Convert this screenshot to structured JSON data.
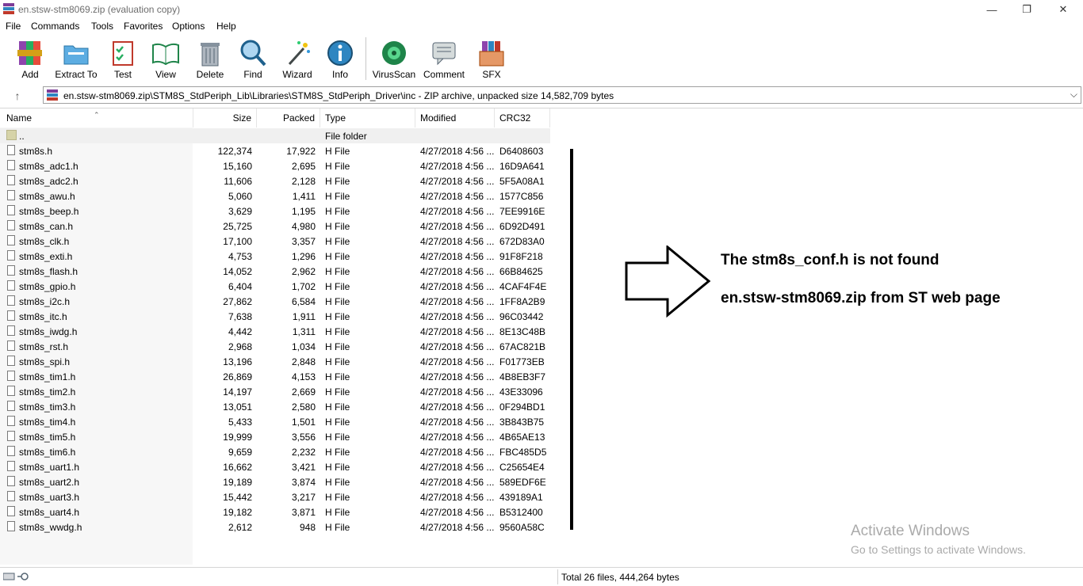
{
  "window": {
    "title": "en.stsw-stm8069.zip (evaluation copy)",
    "controls": {
      "minimize": "—",
      "restore": "❐",
      "close": "✕"
    }
  },
  "menu": [
    "File",
    "Commands",
    "Tools",
    "Favorites",
    "Options",
    "Help"
  ],
  "toolbar": {
    "buttons": [
      "Add",
      "Extract To",
      "Test",
      "View",
      "Delete",
      "Find",
      "Wizard",
      "Info",
      "VirusScan",
      "Comment",
      "SFX"
    ]
  },
  "address": {
    "path": "en.stsw-stm8069.zip\\STM8S_StdPeriph_Lib\\Libraries\\STM8S_StdPeriph_Driver\\inc - ZIP archive, unpacked size 14,582,709 bytes"
  },
  "columns": [
    "Name",
    "Size",
    "Packed",
    "Type",
    "Modified",
    "CRC32"
  ],
  "parent_row": {
    "name": "..",
    "type": "File folder"
  },
  "files": [
    {
      "name": "stm8s.h",
      "size": "122,374",
      "packed": "17,922",
      "type": "H File",
      "modified": "4/27/2018 4:56 ...",
      "crc": "D6408603"
    },
    {
      "name": "stm8s_adc1.h",
      "size": "15,160",
      "packed": "2,695",
      "type": "H File",
      "modified": "4/27/2018 4:56 ...",
      "crc": "16D9A641"
    },
    {
      "name": "stm8s_adc2.h",
      "size": "11,606",
      "packed": "2,128",
      "type": "H File",
      "modified": "4/27/2018 4:56 ...",
      "crc": "5F5A08A1"
    },
    {
      "name": "stm8s_awu.h",
      "size": "5,060",
      "packed": "1,411",
      "type": "H File",
      "modified": "4/27/2018 4:56 ...",
      "crc": "1577C856"
    },
    {
      "name": "stm8s_beep.h",
      "size": "3,629",
      "packed": "1,195",
      "type": "H File",
      "modified": "4/27/2018 4:56 ...",
      "crc": "7EE9916E"
    },
    {
      "name": "stm8s_can.h",
      "size": "25,725",
      "packed": "4,980",
      "type": "H File",
      "modified": "4/27/2018 4:56 ...",
      "crc": "6D92D491"
    },
    {
      "name": "stm8s_clk.h",
      "size": "17,100",
      "packed": "3,357",
      "type": "H File",
      "modified": "4/27/2018 4:56 ...",
      "crc": "672D83A0"
    },
    {
      "name": "stm8s_exti.h",
      "size": "4,753",
      "packed": "1,296",
      "type": "H File",
      "modified": "4/27/2018 4:56 ...",
      "crc": "91F8F218"
    },
    {
      "name": "stm8s_flash.h",
      "size": "14,052",
      "packed": "2,962",
      "type": "H File",
      "modified": "4/27/2018 4:56 ...",
      "crc": "66B84625"
    },
    {
      "name": "stm8s_gpio.h",
      "size": "6,404",
      "packed": "1,702",
      "type": "H File",
      "modified": "4/27/2018 4:56 ...",
      "crc": "4CAF4F4E"
    },
    {
      "name": "stm8s_i2c.h",
      "size": "27,862",
      "packed": "6,584",
      "type": "H File",
      "modified": "4/27/2018 4:56 ...",
      "crc": "1FF8A2B9"
    },
    {
      "name": "stm8s_itc.h",
      "size": "7,638",
      "packed": "1,911",
      "type": "H File",
      "modified": "4/27/2018 4:56 ...",
      "crc": "96C03442"
    },
    {
      "name": "stm8s_iwdg.h",
      "size": "4,442",
      "packed": "1,311",
      "type": "H File",
      "modified": "4/27/2018 4:56 ...",
      "crc": "8E13C48B"
    },
    {
      "name": "stm8s_rst.h",
      "size": "2,968",
      "packed": "1,034",
      "type": "H File",
      "modified": "4/27/2018 4:56 ...",
      "crc": "67AC821B"
    },
    {
      "name": "stm8s_spi.h",
      "size": "13,196",
      "packed": "2,848",
      "type": "H File",
      "modified": "4/27/2018 4:56 ...",
      "crc": "F01773EB"
    },
    {
      "name": "stm8s_tim1.h",
      "size": "26,869",
      "packed": "4,153",
      "type": "H File",
      "modified": "4/27/2018 4:56 ...",
      "crc": "4B8EB3F7"
    },
    {
      "name": "stm8s_tim2.h",
      "size": "14,197",
      "packed": "2,669",
      "type": "H File",
      "modified": "4/27/2018 4:56 ...",
      "crc": "43E33096"
    },
    {
      "name": "stm8s_tim3.h",
      "size": "13,051",
      "packed": "2,580",
      "type": "H File",
      "modified": "4/27/2018 4:56 ...",
      "crc": "0F294BD1"
    },
    {
      "name": "stm8s_tim4.h",
      "size": "5,433",
      "packed": "1,501",
      "type": "H File",
      "modified": "4/27/2018 4:56 ...",
      "crc": "3B843B75"
    },
    {
      "name": "stm8s_tim5.h",
      "size": "19,999",
      "packed": "3,556",
      "type": "H File",
      "modified": "4/27/2018 4:56 ...",
      "crc": "4B65AE13"
    },
    {
      "name": "stm8s_tim6.h",
      "size": "9,659",
      "packed": "2,232",
      "type": "H File",
      "modified": "4/27/2018 4:56 ...",
      "crc": "FBC485D5"
    },
    {
      "name": "stm8s_uart1.h",
      "size": "16,662",
      "packed": "3,421",
      "type": "H File",
      "modified": "4/27/2018 4:56 ...",
      "crc": "C25654E4"
    },
    {
      "name": "stm8s_uart2.h",
      "size": "19,189",
      "packed": "3,874",
      "type": "H File",
      "modified": "4/27/2018 4:56 ...",
      "crc": "589EDF6E"
    },
    {
      "name": "stm8s_uart3.h",
      "size": "15,442",
      "packed": "3,217",
      "type": "H File",
      "modified": "4/27/2018 4:56 ...",
      "crc": "439189A1"
    },
    {
      "name": "stm8s_uart4.h",
      "size": "19,182",
      "packed": "3,871",
      "type": "H File",
      "modified": "4/27/2018 4:56 ...",
      "crc": "B5312400"
    },
    {
      "name": "stm8s_wwdg.h",
      "size": "2,612",
      "packed": "948",
      "type": "H File",
      "modified": "4/27/2018 4:56 ...",
      "crc": "9560A58C"
    }
  ],
  "annotation": {
    "line1": "The stm8s_conf.h is not found",
    "line2": "en.stsw-stm8069.zip from ST web page"
  },
  "watermark": {
    "line1": "Activate Windows",
    "line2": "Go to Settings to activate Windows."
  },
  "status": {
    "text": "Total 26 files, 444,264 bytes"
  }
}
